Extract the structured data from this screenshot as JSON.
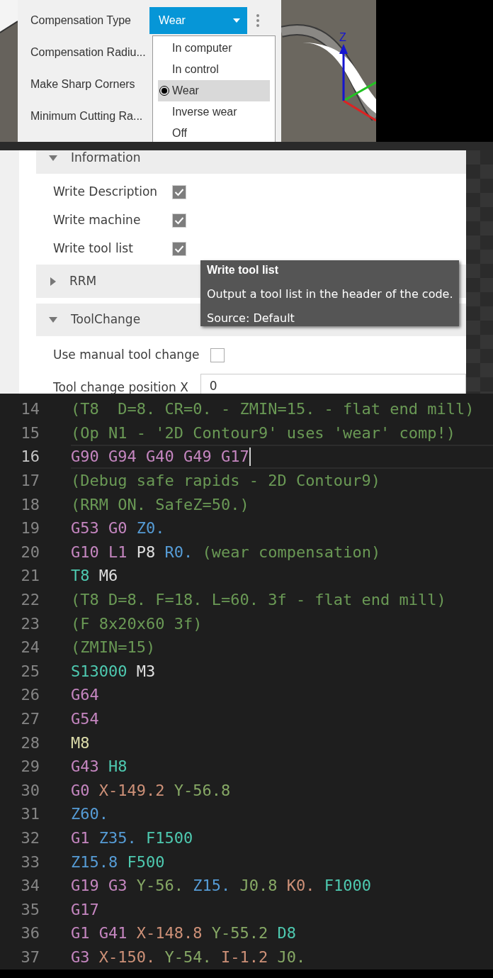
{
  "toolpath_panel": {
    "fields": [
      {
        "label": "Compensation Type"
      },
      {
        "label": "Compensation Radiu..."
      },
      {
        "label": "Make Sharp Corners"
      },
      {
        "label": "Minimum Cutting Ra..."
      }
    ],
    "compensation_type": {
      "value": "Wear",
      "options": [
        {
          "label": "In computer",
          "selected": false
        },
        {
          "label": "In control",
          "selected": false
        },
        {
          "label": "Wear",
          "selected": true
        },
        {
          "label": "Inverse wear",
          "selected": false
        },
        {
          "label": "Off",
          "selected": false
        }
      ]
    }
  },
  "viewport": {
    "axis_label": "Z"
  },
  "post_properties": {
    "groups": [
      {
        "title": "Information",
        "expanded": true,
        "properties": [
          {
            "kind": "checkbox",
            "label": "Write Description",
            "checked": true
          },
          {
            "kind": "checkbox",
            "label": "Write machine",
            "checked": true
          },
          {
            "kind": "checkbox",
            "label": "Write tool list",
            "checked": true
          }
        ]
      },
      {
        "title": "RRM",
        "expanded": false
      },
      {
        "title": "ToolChange",
        "expanded": true,
        "properties": [
          {
            "kind": "checkbox",
            "label": "Use manual tool change",
            "checked": false
          },
          {
            "kind": "number",
            "label": "Tool change position X",
            "value": "0"
          }
        ]
      }
    ],
    "tooltip": {
      "title": "Write tool list",
      "description": "Output a tool list in the header of the code.",
      "source": "Source: Default"
    }
  },
  "editor": {
    "lines": [
      {
        "number": "14",
        "current": false,
        "tokens": [
          {
            "text": "(T8  D=8. CR=0. - ZMIN=15. - flat end mill)",
            "kind": "comment"
          }
        ]
      },
      {
        "number": "15",
        "current": false,
        "tokens": [
          {
            "text": "(Op N1 - '2D Contour9' uses 'wear' comp!)",
            "kind": "comment"
          }
        ]
      },
      {
        "number": "16",
        "current": true,
        "tokens": [
          {
            "text": "G90",
            "kind": "g"
          },
          {
            "text": "G94",
            "kind": "g"
          },
          {
            "text": "G40",
            "kind": "g"
          },
          {
            "text": "G49",
            "kind": "g"
          },
          {
            "text": "G17",
            "kind": "g"
          }
        ]
      },
      {
        "number": "17",
        "current": false,
        "tokens": [
          {
            "text": "(Debug safe rapids - 2D Contour9)",
            "kind": "comment"
          }
        ]
      },
      {
        "number": "18",
        "current": false,
        "tokens": [
          {
            "text": "(RRM ON. SafeZ=50.)",
            "kind": "comment"
          }
        ]
      },
      {
        "number": "19",
        "current": false,
        "tokens": [
          {
            "text": "G53",
            "kind": "g"
          },
          {
            "text": "G0",
            "kind": "g"
          },
          {
            "text": "Z0.",
            "kind": "z"
          }
        ]
      },
      {
        "number": "20",
        "current": false,
        "tokens": [
          {
            "text": "G10",
            "kind": "g"
          },
          {
            "text": "L1",
            "kind": "g"
          },
          {
            "text": "P8",
            "kind": "plain"
          },
          {
            "text": "R0.",
            "kind": "z"
          },
          {
            "text": "(wear compensation)",
            "kind": "comment"
          }
        ]
      },
      {
        "number": "21",
        "current": false,
        "tokens": [
          {
            "text": "T8",
            "kind": "t"
          },
          {
            "text": "M6",
            "kind": "plain"
          }
        ]
      },
      {
        "number": "22",
        "current": false,
        "tokens": [
          {
            "text": "(T8 D=8. F=18. L=60. 3f - flat end mill)",
            "kind": "comment"
          }
        ]
      },
      {
        "number": "23",
        "current": false,
        "tokens": [
          {
            "text": "(F 8x20x60 3f)",
            "kind": "comment"
          }
        ]
      },
      {
        "number": "24",
        "current": false,
        "tokens": [
          {
            "text": "(ZMIN=15)",
            "kind": "comment"
          }
        ]
      },
      {
        "number": "25",
        "current": false,
        "tokens": [
          {
            "text": "S13000",
            "kind": "t"
          },
          {
            "text": "M3",
            "kind": "plain"
          }
        ]
      },
      {
        "number": "26",
        "current": false,
        "tokens": [
          {
            "text": "G64",
            "kind": "g"
          }
        ]
      },
      {
        "number": "27",
        "current": false,
        "tokens": [
          {
            "text": "G54",
            "kind": "g"
          }
        ]
      },
      {
        "number": "28",
        "current": false,
        "tokens": [
          {
            "text": "M8",
            "kind": "coolant"
          }
        ]
      },
      {
        "number": "29",
        "current": false,
        "tokens": [
          {
            "text": "G43",
            "kind": "g"
          },
          {
            "text": "H8",
            "kind": "t"
          }
        ]
      },
      {
        "number": "30",
        "current": false,
        "tokens": [
          {
            "text": "G0",
            "kind": "g"
          },
          {
            "text": "X-149.2",
            "kind": "x"
          },
          {
            "text": "Y-56.8",
            "kind": "y"
          }
        ]
      },
      {
        "number": "31",
        "current": false,
        "tokens": [
          {
            "text": "Z60.",
            "kind": "z"
          }
        ]
      },
      {
        "number": "32",
        "current": false,
        "tokens": [
          {
            "text": "G1",
            "kind": "g"
          },
          {
            "text": "Z35.",
            "kind": "z"
          },
          {
            "text": "F1500",
            "kind": "t"
          }
        ]
      },
      {
        "number": "33",
        "current": false,
        "tokens": [
          {
            "text": "Z15.8",
            "kind": "z"
          },
          {
            "text": "F500",
            "kind": "t"
          }
        ]
      },
      {
        "number": "34",
        "current": false,
        "tokens": [
          {
            "text": "G19",
            "kind": "g"
          },
          {
            "text": "G3",
            "kind": "g"
          },
          {
            "text": "Y-56.",
            "kind": "y"
          },
          {
            "text": "Z15.",
            "kind": "z"
          },
          {
            "text": "J0.8",
            "kind": "y"
          },
          {
            "text": "K0.",
            "kind": "x"
          },
          {
            "text": "F1000",
            "kind": "t"
          }
        ]
      },
      {
        "number": "35",
        "current": false,
        "tokens": [
          {
            "text": "G17",
            "kind": "g"
          }
        ]
      },
      {
        "number": "36",
        "current": false,
        "tokens": [
          {
            "text": "G1",
            "kind": "g"
          },
          {
            "text": "G41",
            "kind": "g"
          },
          {
            "text": "X-148.8",
            "kind": "x"
          },
          {
            "text": "Y-55.2",
            "kind": "y"
          },
          {
            "text": "D8",
            "kind": "t"
          }
        ]
      },
      {
        "number": "37",
        "current": false,
        "tokens": [
          {
            "text": "G3",
            "kind": "g"
          },
          {
            "text": "X-150.",
            "kind": "x"
          },
          {
            "text": "Y-54.",
            "kind": "y"
          },
          {
            "text": "I-1.2",
            "kind": "x"
          },
          {
            "text": "J0.",
            "kind": "y"
          }
        ]
      }
    ]
  }
}
